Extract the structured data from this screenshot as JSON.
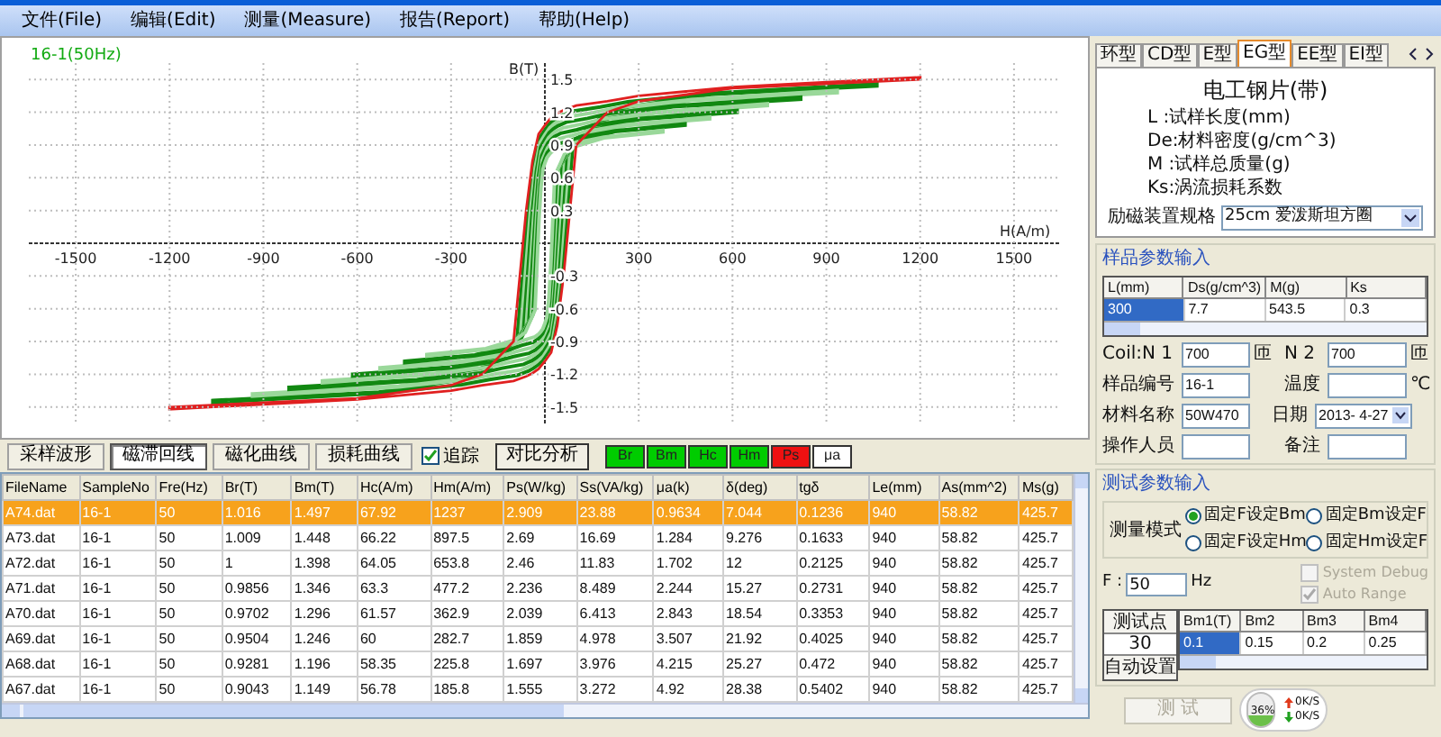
{
  "menu": [
    "文件(File)",
    "编辑(Edit)",
    "测量(Measure)",
    "报告(Report)",
    "帮助(Help)"
  ],
  "chart": {
    "caption": "16-1(50Hz)",
    "chart_data": {
      "type": "line",
      "xlabel": "H(A/m)",
      "ylabel": "B(T)",
      "grid": true,
      "xlim": [
        -1650,
        1650
      ],
      "ylim": [
        -1.65,
        1.65
      ],
      "xticks": [
        -1500,
        -1200,
        -900,
        -600,
        -300,
        300,
        600,
        900,
        1200,
        1500
      ],
      "yticks": [
        -1.5,
        -1.2,
        -0.9,
        -0.6,
        -0.3,
        0.3,
        0.6,
        0.9,
        1.2,
        1.5
      ]
    }
  },
  "view_tabs": [
    {
      "label": "采样波形",
      "selected": false
    },
    {
      "label": "磁滞回线",
      "selected": true
    },
    {
      "label": "磁化曲线",
      "selected": false
    },
    {
      "label": "损耗曲线",
      "selected": false
    }
  ],
  "track_checkbox": {
    "label": "追踪",
    "checked": true
  },
  "compare_button": "对比分析",
  "param_toggles": [
    {
      "label": "Br",
      "color": "#00cc00"
    },
    {
      "label": "Bm",
      "color": "#00cc00"
    },
    {
      "label": "Hc",
      "color": "#00cc00"
    },
    {
      "label": "Hm",
      "color": "#00cc00"
    },
    {
      "label": "Ps",
      "color": "#ee1111"
    },
    {
      "label": "μa",
      "color": "#ffffff"
    }
  ],
  "table": {
    "columns": [
      "FileName",
      "SampleNo",
      "Fre(Hz)",
      "Br(T)",
      "Bm(T)",
      "Hc(A/m)",
      "Hm(A/m)",
      "Ps(W/kg)",
      "Ss(VA/kg)",
      "μa(k)",
      "δ(deg)",
      "tgδ",
      "Le(mm)",
      "As(mm^2)",
      "Ms(g)"
    ],
    "rows": [
      {
        "selected": true,
        "cells": [
          "A74.dat",
          "16-1",
          "50",
          "1.016",
          "1.497",
          "67.92",
          "1237",
          "2.909",
          "23.88",
          "0.9634",
          "7.044",
          "0.1236",
          "940",
          "58.82",
          "425.7"
        ]
      },
      {
        "selected": false,
        "cells": [
          "A73.dat",
          "16-1",
          "50",
          "1.009",
          "1.448",
          "66.22",
          "897.5",
          "2.69",
          "16.69",
          "1.284",
          "9.276",
          "0.1633",
          "940",
          "58.82",
          "425.7"
        ]
      },
      {
        "selected": false,
        "cells": [
          "A72.dat",
          "16-1",
          "50",
          "1",
          "1.398",
          "64.05",
          "653.8",
          "2.46",
          "11.83",
          "1.702",
          "12",
          "0.2125",
          "940",
          "58.82",
          "425.7"
        ]
      },
      {
        "selected": false,
        "cells": [
          "A71.dat",
          "16-1",
          "50",
          "0.9856",
          "1.346",
          "63.3",
          "477.2",
          "2.236",
          "8.489",
          "2.244",
          "15.27",
          "0.2731",
          "940",
          "58.82",
          "425.7"
        ]
      },
      {
        "selected": false,
        "cells": [
          "A70.dat",
          "16-1",
          "50",
          "0.9702",
          "1.296",
          "61.57",
          "362.9",
          "2.039",
          "6.413",
          "2.843",
          "18.54",
          "0.3353",
          "940",
          "58.82",
          "425.7"
        ]
      },
      {
        "selected": false,
        "cells": [
          "A69.dat",
          "16-1",
          "50",
          "0.9504",
          "1.246",
          "60",
          "282.7",
          "1.859",
          "4.978",
          "3.507",
          "21.92",
          "0.4025",
          "940",
          "58.82",
          "425.7"
        ]
      },
      {
        "selected": false,
        "cells": [
          "A68.dat",
          "16-1",
          "50",
          "0.9281",
          "1.196",
          "58.35",
          "225.8",
          "1.697",
          "3.976",
          "4.215",
          "25.27",
          "0.472",
          "940",
          "58.82",
          "425.7"
        ]
      },
      {
        "selected": false,
        "cells": [
          "A67.dat",
          "16-1",
          "50",
          "0.9043",
          "1.149",
          "56.78",
          "185.8",
          "1.555",
          "3.272",
          "4.92",
          "28.38",
          "0.5402",
          "940",
          "58.82",
          "425.7"
        ]
      }
    ]
  },
  "core_tabs": [
    {
      "label": "环型",
      "selected": false
    },
    {
      "label": "CD型",
      "selected": false
    },
    {
      "label": "E型",
      "selected": false
    },
    {
      "label": "EG型",
      "selected": true
    },
    {
      "label": "EE型",
      "selected": false
    },
    {
      "label": "EI型",
      "selected": false
    }
  ],
  "core_info": {
    "title": "电工钢片(带)",
    "lines": [
      "L :试样长度(mm)",
      "De:材料密度(g/cm^3)",
      "M :试样总质量(g)",
      "Ks:涡流损耗系数"
    ]
  },
  "fixture": {
    "label": "励磁装置规格",
    "value": "25cm 爱泼斯坦方圈"
  },
  "sample_group": {
    "title": "样品参数输入",
    "columns": [
      "L(mm)",
      "Ds(g/cm^3)",
      "M(g)",
      "Ks"
    ],
    "values": [
      {
        "text": "300",
        "selected": true
      },
      {
        "text": "7.7",
        "selected": false
      },
      {
        "text": "543.5",
        "selected": false
      },
      {
        "text": "0.3",
        "selected": false
      }
    ],
    "fields": [
      [
        {
          "kind": "text",
          "label": "Coil:N 1",
          "value": "700",
          "unit": "匝"
        },
        {
          "kind": "text",
          "label": "N 2",
          "value": "700",
          "unit": "匝"
        }
      ],
      [
        {
          "kind": "text",
          "label": "样品编号",
          "value": "16-1"
        },
        {
          "kind": "text",
          "label": "温度",
          "unit": "℃"
        }
      ],
      [
        {
          "kind": "text",
          "label": "材料名称",
          "value": "50W470"
        },
        {
          "kind": "date",
          "label": "日期",
          "value": "2013- 4-27"
        }
      ],
      [
        {
          "kind": "text",
          "label": "操作人员"
        },
        {
          "kind": "text",
          "label": "备注"
        }
      ]
    ]
  },
  "test_group": {
    "title": "测试参数输入",
    "mode_label": "测量模式",
    "modes": [
      {
        "label": "固定F设定Bm",
        "selected": true
      },
      {
        "label": "固定Bm设定F",
        "selected": false
      },
      {
        "label": "固定F设定Hm",
        "selected": false
      },
      {
        "label": "固定Hm设定F",
        "selected": false
      }
    ],
    "checkboxes": [
      {
        "label": "System Debug",
        "checked": false,
        "disabled": true
      },
      {
        "label": "Auto Range",
        "checked": true,
        "disabled": true
      }
    ],
    "frequency": {
      "label": "F :",
      "value": "50",
      "unit": "Hz"
    },
    "points_label": "测试点",
    "points_value": "30",
    "auto_button": "自动设置",
    "columns": [
      "Bm1(T)",
      "Bm2",
      "Bm3",
      "Bm4"
    ],
    "values": [
      {
        "text": "0.1",
        "selected": true
      },
      {
        "text": "0.15",
        "selected": false
      },
      {
        "text": "0.2",
        "selected": false
      },
      {
        "text": "0.25",
        "selected": false
      }
    ]
  },
  "test_button": {
    "label": "测 试",
    "disabled": true
  },
  "monitor": {
    "percent": "36%",
    "level": 0.36,
    "up": "0K/S",
    "down": "0K/S"
  }
}
